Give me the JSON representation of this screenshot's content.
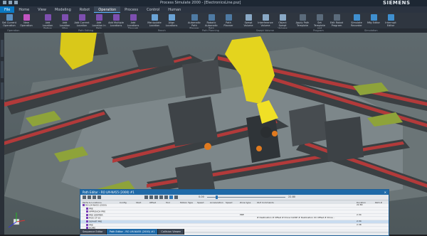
{
  "titlebar": {
    "title": "Process Simulate 2000 - [ElectronicsLine.psz]",
    "brand": "SIEMENS"
  },
  "menu": [
    "File",
    "Home",
    "View",
    "Modeling",
    "Robot",
    "Operation",
    "Process",
    "Control",
    "Human"
  ],
  "menu_active_index": 5,
  "ribbon": {
    "buttons": [
      "Set Current Operation",
      "New Operation",
      "Add Location Before",
      "Add Location After",
      "Add Current Location",
      "Add Location in Path",
      "Add Multiple Locations",
      "Add Locations Through Points",
      "Manipulate Location",
      "Align Locations",
      "Automatic Path Planner",
      "Robotic Automatic Path Planner",
      "Path Planner",
      "Swept Volume",
      "Interference Volume",
      "Object Swept Volume",
      "Apply Path Template",
      "Set Template and Robotics",
      "Edit Robot Program",
      "Simulate Recorder",
      "Mfg Editor",
      "Interrupt Editor"
    ],
    "groups": [
      "Operation",
      "Path Editing",
      "Reach",
      "Path Planning",
      "Swept Volume",
      "Program",
      "Simulation"
    ]
  },
  "path_editor": {
    "title": "Path Editor - RO LM-NA55 (2000) #1",
    "time_start": "0.00",
    "time_end": "22.80",
    "columns": [
      "Paths & Locations",
      "Config",
      "Start",
      "Offset",
      "Tool",
      "Motion Type",
      "Speed",
      "Acceleration",
      "Speed",
      "Zone type",
      "OLP Commands",
      "Duration",
      "Path #"
    ],
    "rows": [
      {
        "name": "RO LM-NA55 (2000)",
        "speed": "",
        "zone": "",
        "olp": "",
        "duration": "22.80",
        "highlight": false
      },
      {
        "name": "PRE",
        "speed": "",
        "zone": "",
        "olp": "",
        "duration": "",
        "highlight": false
      },
      {
        "name": "APPROACH PRE",
        "speed": "",
        "zone": "",
        "olp": "",
        "duration": "",
        "highlight": false
      },
      {
        "name": "PRE GRIPPER",
        "speed": "",
        "zone": "PRE",
        "olp": "",
        "duration": "2.34",
        "highlight": false
      },
      {
        "name": "PICK CT-15",
        "speed": "",
        "zone": "",
        "olp": "# Destination  # Offset  # Drive CLOSE  # Destination  UC Offset  # Drive ..",
        "duration": "",
        "highlight": false
      },
      {
        "name": "DEPART PRE",
        "speed": "",
        "zone": "",
        "olp": "",
        "duration": "2.34",
        "highlight": true
      },
      {
        "name": "PRE",
        "speed": "",
        "zone": "",
        "olp": "",
        "duration": "2.38",
        "highlight": false
      },
      {
        "name": "HOME",
        "speed": "",
        "zone": "",
        "olp": "",
        "duration": "",
        "highlight": false
      }
    ]
  },
  "bottom_tabs": [
    "Sequence Editor",
    "Path Editor - RO LM-NA55 (2000) #1",
    "Collision Viewer"
  ],
  "bottom_tab_selected": 1
}
